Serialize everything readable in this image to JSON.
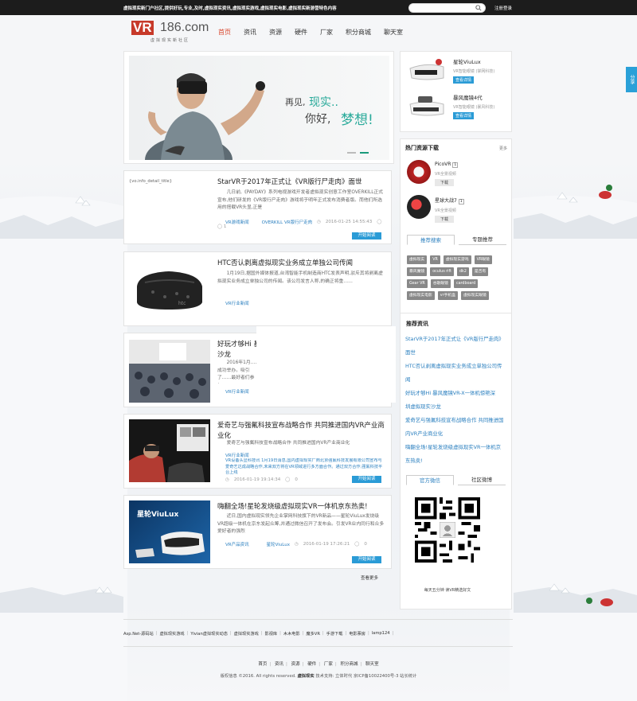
{
  "topbar": {
    "slogan": "虚拟现实新门户社区,提供好玩,专业,及时,虚拟现实资讯,虚拟现实游戏,虚拟现实电影,虚拟现实新游营特色内容",
    "search_placeholder": "",
    "login": "注册登录"
  },
  "logo": {
    "vr": "VR",
    "num": "186.com",
    "sub": "虚拟现实新社区"
  },
  "nav": [
    "首页",
    "资讯",
    "资源",
    "硬件",
    "厂家",
    "积分商城",
    "聊天室"
  ],
  "banner": {
    "t1": "再见,",
    "t2": "现实..",
    "t3": "你好,",
    "t4": "梦想!"
  },
  "articles": [
    {
      "title": "StarVR于2017年正式让《VR版行尸走肉》面世",
      "img_alt": "{vo.info_detail_title}",
      "summary": "几日前,《PAYDAY》系列电视游戏开发者虚拟现实创意工作室OVERKILL正式宣布,他们研发的《VR版行尸走肉》游戏将于明年正式发布消费者版。而他们所选用的搭载VR头显,正是",
      "tags": [
        "VR游戏新闻",
        "OVERKILL VR版行尸走肉"
      ],
      "date": "2016-01-25 14:55:43",
      "comments": "1",
      "btn": "开始阅读"
    },
    {
      "title": "HTC否认剥离虚拟现实业务成立单独公司传闻",
      "summary": "1月19日,据国外媒体报道,台湾智能手机制造商HTC发表声明,驳斥其将剥离虚拟现实业务成立单独公司的传闻。该公司发言人称,的确正将重……",
      "tags": [
        "VR行业新闻"
      ]
    },
    {
      "title": "好玩才够Hi 暴风魔镜VR-X一体机惊艳深圳虚拟现实沙龙",
      "title_visible": "好玩才够Hi 暴",
      "title_line2": "沙龙",
      "summary": "2016年1月……成功举办。吸引了……最好者们参与。",
      "tags": [
        "VR行业新闻"
      ]
    },
    {
      "title": "爱奇艺与强氟科技宣布战略合作 共同推进国内VR产业商业化",
      "summary": "爱奇艺与强氟科技宣布战略合作 共同推进国内VR产业商业化",
      "tags": [
        "VR行业新闻"
      ],
      "extra": "VR设备头显科技讯 1月19日消息,国内虚拟现实厂商北京强氟科技发展有限公司宣布与爱奇艺达成战略合作,未来双方将在VR领域进行多方面合作。通过双方合作,强氟科技平台上线",
      "date": "2016-01-19 19:14:34",
      "comments": "0",
      "btn": "开始阅读"
    },
    {
      "title": "嗨翻全场!星轮发烧级虚拟现实VR一体机京东热卖!",
      "summary": "近日,国内虚拟现实领先企业掌网科技旗下的VR新品——星轮ViuLux发烧级VR超级一体机在京东发起众筹,并通过微信召开了发布会。引发VR业内同行和众多爱好者的强烈",
      "tags": [
        "VR产品资讯",
        "星轮ViuLux"
      ],
      "date": "2016-01-19 17:26:21",
      "comments": "0",
      "btn": "开始阅读",
      "thumb_title": "星轮ViuLux"
    }
  ],
  "more": "查看更多",
  "hardware": [
    {
      "name": "星轮ViuLux",
      "desc": "VR智能眼镜 (掌网科技)",
      "tag": "查看详情"
    },
    {
      "name": "暴风魔镜4代",
      "desc": "VR智能眼镜 (暴风科技)",
      "tag": "查看详情"
    }
  ],
  "hot": {
    "title": "热门资源下载",
    "more": "更多",
    "items": [
      {
        "name": "PicoVR",
        "badge": "1",
        "desc": "VR全景视频",
        "dl": "下载"
      },
      {
        "name": "星球大战7",
        "badge": "1",
        "desc": "VR全景视频",
        "dl": "下载"
      }
    ]
  },
  "search_tabs": [
    "推荐搜索",
    "专题推荐"
  ],
  "keywords": [
    "虚拟现实",
    "VR",
    "虚拟现实游戏",
    "VR眼镜",
    "暴风魔镜",
    "oculus rift",
    "dk2",
    "是否有",
    "Gear VR",
    "谷歌眼镜",
    "cardboard",
    "虚拟现实电影",
    "vr手机盒",
    "虚拟现实眼镜"
  ],
  "recommend": {
    "title": "推荐资讯",
    "items": [
      "StarVR于2017年正式让《VR版行尸走肉》",
      "面世",
      "HTC否认剥离虚拟现实业务成立单独公司传",
      "闻",
      "好玩才够Hi 暴风魔镜VR-X一体机惊艳深",
      "圳虚拟现实沙龙",
      "爱奇艺与强氟科技宣布战略合作 共同推进国",
      "内VR产业商业化",
      "嗨翻全场!星轮发烧级虚拟现实VR一体机京",
      "东热卖!"
    ]
  },
  "social_tabs": [
    "官方微信",
    "社区微博"
  ],
  "qr_caption": "每天五分钟 读VR精选好文",
  "share": "分享",
  "footer": {
    "links": [
      "Asp.Net-源码站",
      "虚拟现实游戏",
      "Yivian虚拟现实动态",
      "虚拟现实游戏",
      "影视库",
      "木木电影",
      "魔多VR",
      "手游下载",
      "电影票房",
      "lamp124"
    ],
    "nav": [
      "首页",
      "资讯",
      "资源",
      "硬件",
      "厂家",
      "积分商城",
      "聊天室"
    ],
    "copy_prefix": "版权信息 ©2016. All rights reserved.",
    "copy_brand": "虚拟现实",
    "copy_suffix": "技术支持: 立体时代 京ICP备10022400号-3 站长统计"
  },
  "colors": {
    "accent": "#d9452c",
    "blue": "#2a9bd6",
    "teal": "#29aa9a",
    "topbar": "#1c1c1c"
  }
}
